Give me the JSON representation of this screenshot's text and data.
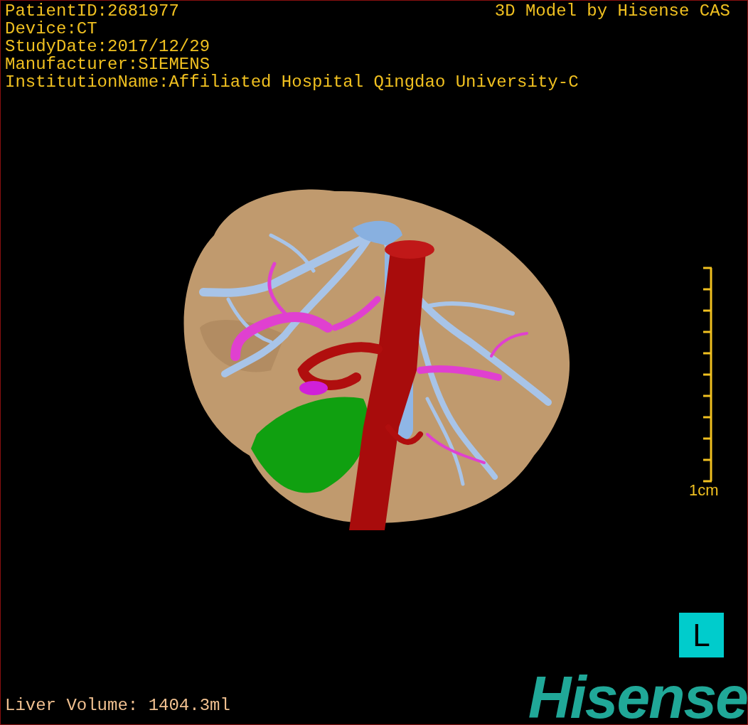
{
  "info_lines": [
    "PatientID:2681977",
    "Device:CT",
    "StudyDate:2017/12/29",
    "Manufacturer:SIEMENS",
    "InstitutionName:Affiliated Hospital Qingdao University-C"
  ],
  "credit": "3D Model by Hisense CAS",
  "scale": {
    "label": "1cm"
  },
  "orientation": {
    "label": "L"
  },
  "volume": "Liver Volume: 1404.3ml",
  "logo": "Hisense"
}
